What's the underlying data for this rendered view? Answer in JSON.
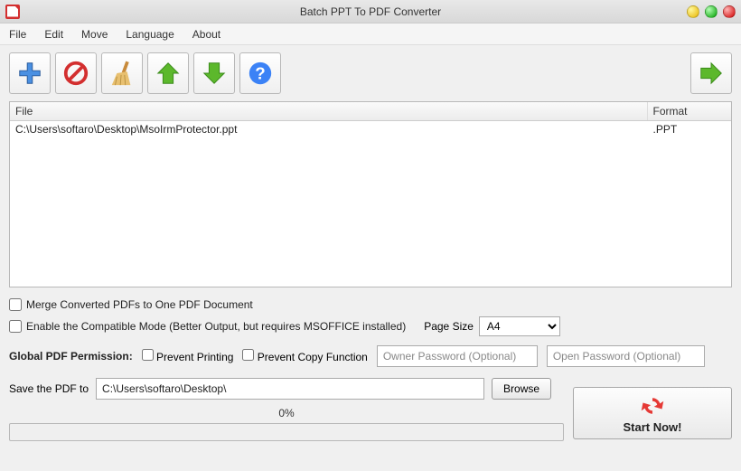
{
  "window": {
    "title": "Batch PPT To PDF Converter"
  },
  "menu": {
    "file": "File",
    "edit": "Edit",
    "move": "Move",
    "language": "Language",
    "about": "About"
  },
  "table": {
    "headers": {
      "file": "File",
      "format": "Format"
    },
    "rows": [
      {
        "file": "C:\\Users\\softaro\\Desktop\\MsoIrmProtector.ppt",
        "format": ".PPT"
      }
    ]
  },
  "options": {
    "merge": "Merge Converted PDFs to One PDF Document",
    "compat": "Enable the Compatible Mode (Better Output, but requires MSOFFICE installed)",
    "page_size_label": "Page Size",
    "page_size_value": "A4"
  },
  "perm": {
    "label": "Global PDF Permission:",
    "prevent_print": "Prevent Printing",
    "prevent_copy": "Prevent Copy Function",
    "owner_ph": "Owner Password (Optional)",
    "open_ph": "Open Password (Optional)"
  },
  "save": {
    "label": "Save the PDF to",
    "path": "C:\\Users\\softaro\\Desktop\\",
    "browse": "Browse"
  },
  "progress": {
    "text": "0%"
  },
  "start": {
    "label": "Start Now!"
  }
}
